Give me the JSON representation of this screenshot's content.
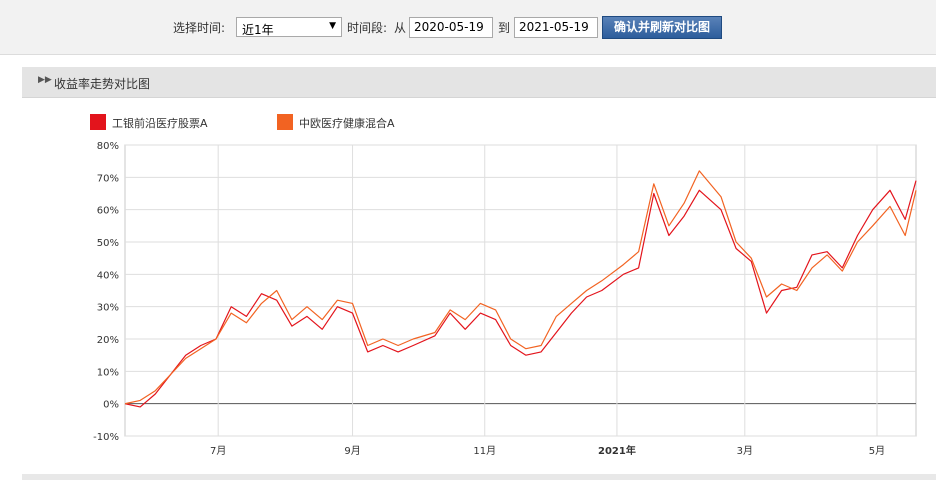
{
  "toolbar": {
    "select_time_label": "选择时间:",
    "period_value": "近1年",
    "range_label": "时间段:",
    "from_label": "从",
    "start_date": "2020-05-19",
    "to_label": "到",
    "end_date": "2021-05-19",
    "confirm_label": "确认并刷新对比图"
  },
  "panel": {
    "title": "收益率走势对比图"
  },
  "colors": {
    "series1": "#e3141c",
    "series2": "#f26322"
  },
  "chart_data": {
    "type": "line",
    "x_ticks": [
      "7月",
      "9月",
      "11月",
      "2021年",
      "3月",
      "5月"
    ],
    "y_ticks": [
      "80%",
      "70%",
      "60%",
      "50%",
      "40%",
      "30%",
      "20%",
      "10%",
      "0%",
      "-10%"
    ],
    "ylim": [
      -10,
      80
    ],
    "grid": true,
    "legend_position": "top-left",
    "x_dates": [
      "2020-05-19",
      "2020-05-26",
      "2020-06-02",
      "2020-06-09",
      "2020-06-16",
      "2020-06-23",
      "2020-06-30",
      "2020-07-07",
      "2020-07-14",
      "2020-07-21",
      "2020-07-28",
      "2020-08-04",
      "2020-08-11",
      "2020-08-18",
      "2020-08-25",
      "2020-09-01",
      "2020-09-08",
      "2020-09-15",
      "2020-09-22",
      "2020-09-29",
      "2020-10-09",
      "2020-10-16",
      "2020-10-23",
      "2020-10-30",
      "2020-11-06",
      "2020-11-13",
      "2020-11-20",
      "2020-11-27",
      "2020-12-04",
      "2020-12-11",
      "2020-12-18",
      "2020-12-25",
      "2021-01-04",
      "2021-01-11",
      "2021-01-18",
      "2021-01-25",
      "2021-02-01",
      "2021-02-08",
      "2021-02-18",
      "2021-02-25",
      "2021-03-04",
      "2021-03-11",
      "2021-03-18",
      "2021-03-25",
      "2021-04-01",
      "2021-04-08",
      "2021-04-15",
      "2021-04-22",
      "2021-04-29",
      "2021-05-07",
      "2021-05-14",
      "2021-05-19"
    ],
    "series": [
      {
        "name": "工银前沿医疗股票A",
        "values": [
          0,
          -1,
          3,
          9,
          15,
          18,
          20,
          30,
          27,
          34,
          32,
          24,
          27,
          23,
          30,
          28,
          16,
          18,
          16,
          18,
          21,
          28,
          23,
          28,
          26,
          18,
          15,
          16,
          22,
          28,
          33,
          35,
          40,
          42,
          65,
          52,
          58,
          66,
          60,
          48,
          44,
          28,
          35,
          36,
          46,
          47,
          42,
          52,
          60,
          66,
          57,
          69
        ]
      },
      {
        "name": "中欧医疗健康混合A",
        "values": [
          0,
          1,
          4,
          9,
          14,
          17,
          20,
          28,
          25,
          31,
          35,
          26,
          30,
          26,
          32,
          31,
          18,
          20,
          18,
          20,
          22,
          29,
          26,
          31,
          29,
          20,
          17,
          18,
          27,
          31,
          35,
          38,
          43,
          47,
          68,
          55,
          62,
          72,
          64,
          50,
          45,
          33,
          37,
          35,
          42,
          46,
          41,
          50,
          55,
          61,
          52,
          66
        ]
      }
    ]
  }
}
